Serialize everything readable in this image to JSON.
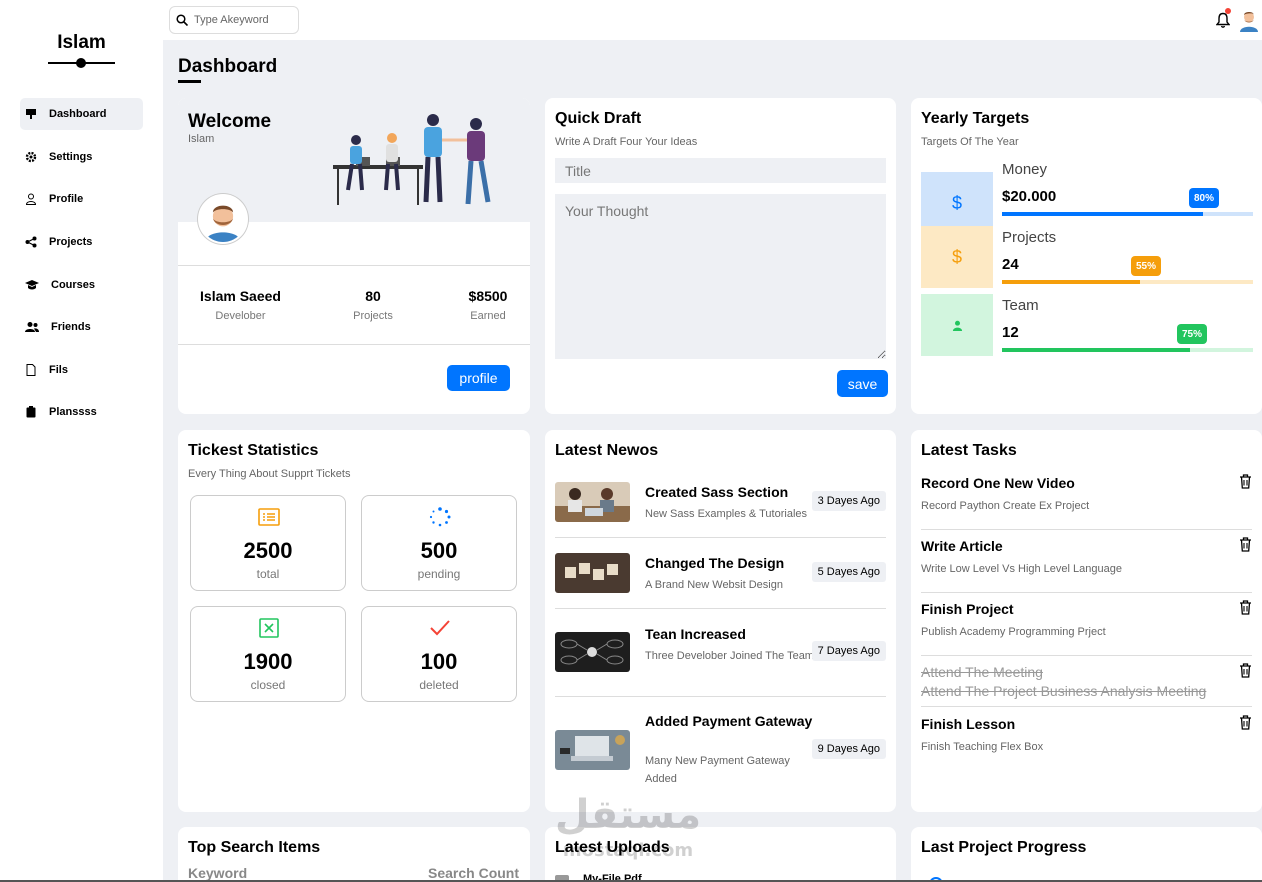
{
  "brand": "Islam",
  "search": {
    "placeholder": "Type Akeyword"
  },
  "nav": [
    {
      "label": "Dashboard",
      "icon": "chalkboard-icon"
    },
    {
      "label": "Settings",
      "icon": "gear-icon"
    },
    {
      "label": "Profile",
      "icon": "user-icon"
    },
    {
      "label": "Projects",
      "icon": "share-icon"
    },
    {
      "label": "Courses",
      "icon": "graduation-cap-icon"
    },
    {
      "label": "Friends",
      "icon": "users-icon"
    },
    {
      "label": "Fils",
      "icon": "file-icon"
    },
    {
      "label": "Planssss",
      "icon": "clipboard-icon"
    }
  ],
  "page_title": "Dashboard",
  "welcome": {
    "title": "Welcome",
    "subtitle": "Islam",
    "stats": [
      {
        "value": "Islam Saeed",
        "label": "Develober"
      },
      {
        "value": "80",
        "label": "Projects"
      },
      {
        "value": "$8500",
        "label": "Earned"
      }
    ],
    "button": "profile"
  },
  "draft": {
    "title": "Quick Draft",
    "subtitle": "Write A Draft Four Your Ideas",
    "title_placeholder": "Title",
    "body_placeholder": "Your Thought",
    "button": "save"
  },
  "targets": {
    "title": "Yearly Targets",
    "subtitle": "Targets Of The Year",
    "items": [
      {
        "name": "Money",
        "value": "$20.000",
        "percent_label": "80%",
        "percent": 80,
        "color": "#0075ff",
        "bg": "#cfe3fb",
        "icon": "dollar-icon",
        "glyph": "$"
      },
      {
        "name": "Projects",
        "value": "24",
        "percent_label": "55%",
        "percent": 55,
        "color": "#f59e0b",
        "bg": "#fde9c4",
        "icon": "dollar-icon",
        "glyph": "$"
      },
      {
        "name": "Team",
        "value": "12",
        "percent_label": "75%",
        "percent": 75,
        "color": "#22c55e",
        "bg": "#d2f5de",
        "icon": "user-icon",
        "glyph": ""
      }
    ]
  },
  "tickets": {
    "title": "Tickest Statistics",
    "subtitle": "Every Thing About Supprt Tickets",
    "items": [
      {
        "value": "2500",
        "label": "total",
        "icon": "list-icon",
        "color": "#f59e0b"
      },
      {
        "value": "500",
        "label": "pending",
        "icon": "spinner-icon",
        "color": "#0075ff"
      },
      {
        "value": "1900",
        "label": "closed",
        "icon": "close-square-icon",
        "color": "#22c55e"
      },
      {
        "value": "100",
        "label": "deleted",
        "icon": "check-icon",
        "color": "#f44336"
      }
    ]
  },
  "news": {
    "title": "Latest Newos",
    "items": [
      {
        "title": "Created Sass Section",
        "desc": "New Sass Examples & Tutoriales",
        "ago": "3 Dayes Ago"
      },
      {
        "title": "Changed The Design",
        "desc": "A Brand New Websit Design",
        "ago": "5 Dayes Ago"
      },
      {
        "title": "Tean Increased",
        "desc": "Three Develober Joined The Team",
        "ago": "7 Dayes Ago"
      },
      {
        "title": "Added Payment Gateway",
        "desc": "Many New Payment Gateway Added",
        "ago": "9 Dayes Ago"
      }
    ]
  },
  "tasks": {
    "title": "Latest Tasks",
    "items": [
      {
        "title": "Record One New Video",
        "desc": "Record Paython Create Ex Project",
        "done": false
      },
      {
        "title": "Write Article",
        "desc": "Write Low Level Vs High Level Language",
        "done": false
      },
      {
        "title": "Finish Project",
        "desc": "Publish Academy Programming Prject",
        "done": false
      },
      {
        "title": "Attend The Meeting",
        "desc": "Attend The Project Business Analysis Meeting",
        "done": true
      },
      {
        "title": "Finish Lesson",
        "desc": "Finish Teaching Flex Box",
        "done": false
      }
    ]
  },
  "top_search": {
    "title": "Top Search Items",
    "col_keyword": "Keyword",
    "col_count": "Search Count"
  },
  "uploads": {
    "title": "Latest Uploads",
    "first_file": "My-File.Pdf"
  },
  "progress": {
    "title": "Last Project Progress"
  },
  "watermark": {
    "line1": "مستقل",
    "line2": "mostaql.com"
  }
}
